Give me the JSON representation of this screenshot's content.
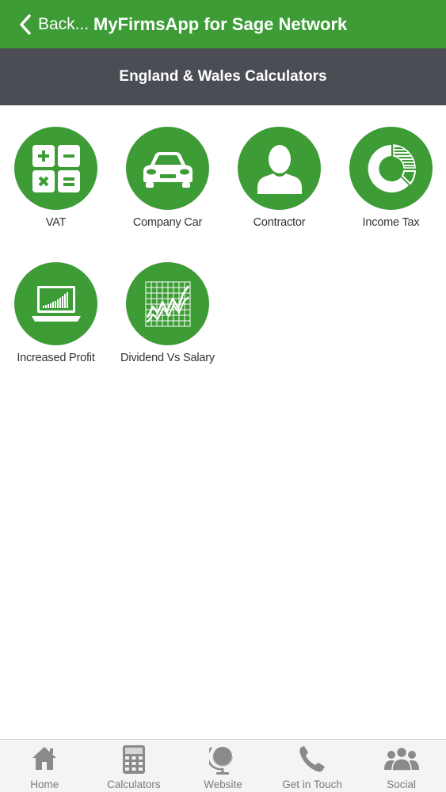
{
  "header": {
    "back_label": "Back...",
    "title": "MyFirmsApp for Sage Network",
    "background_color": "#3d9c36"
  },
  "subheader": {
    "title": "England & Wales Calculators",
    "background_color": "#4b4d55"
  },
  "calculators": [
    {
      "label": "VAT",
      "icon": "calculator-keys-icon"
    },
    {
      "label": "Company Car",
      "icon": "car-icon"
    },
    {
      "label": "Contractor",
      "icon": "person-icon"
    },
    {
      "label": "Income Tax",
      "icon": "donut-chart-icon"
    },
    {
      "label": "Increased Profit",
      "icon": "laptop-chart-icon"
    },
    {
      "label": "Dividend Vs Salary",
      "icon": "line-graph-icon"
    }
  ],
  "tabbar": {
    "items": [
      {
        "label": "Home",
        "icon": "home-icon"
      },
      {
        "label": "Calculators",
        "icon": "calculator-icon"
      },
      {
        "label": "Website",
        "icon": "globe-icon"
      },
      {
        "label": "Get in Touch",
        "icon": "phone-icon"
      },
      {
        "label": "Social",
        "icon": "people-icon"
      }
    ],
    "icon_color": "#8a8a8a"
  },
  "accent_color": "#3d9c36"
}
